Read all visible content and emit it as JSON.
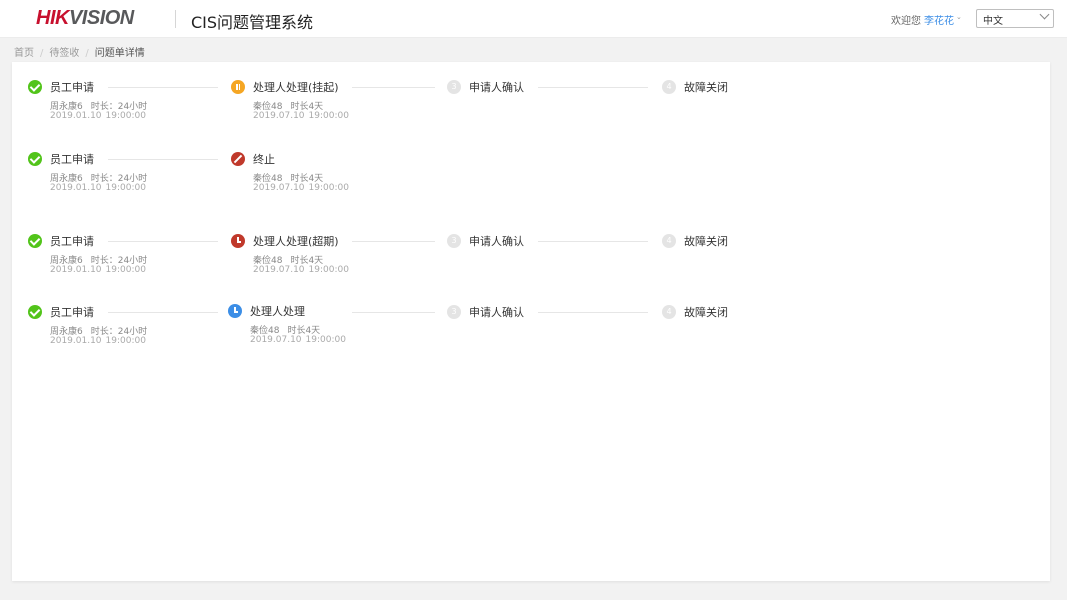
{
  "header": {
    "logo_red": "HIK",
    "logo_grey": "VISION",
    "app_title": "CIS问题管理系统",
    "welcome": "欢迎您",
    "username": "李花花",
    "language": "中文"
  },
  "breadcrumb": [
    "首页",
    "待签收",
    "问题单详情"
  ],
  "flows": [
    {
      "steps": [
        {
          "status": "done",
          "title": "员工申请",
          "person": "周永康6",
          "duration": "时长：24小时",
          "date": "2019.01.10",
          "time": "19:00:00"
        },
        {
          "status": "pause",
          "title": "处理人处理(挂起)",
          "person": "秦俭48",
          "duration": "时长4天",
          "date": "2019.07.10",
          "time": "19:00:00"
        },
        {
          "status": "wait",
          "num": "3",
          "title": "申请人确认"
        },
        {
          "status": "wait",
          "num": "4",
          "title": "故障关闭"
        }
      ]
    },
    {
      "steps": [
        {
          "status": "done",
          "title": "员工申请",
          "person": "周永康6",
          "duration": "时长：24小时",
          "date": "2019.01.10",
          "time": "19:00:00"
        },
        {
          "status": "stop",
          "title": "终止",
          "person": "秦俭48",
          "duration": "时长4天",
          "date": "2019.07.10",
          "time": "19:00:00"
        }
      ]
    },
    {
      "steps": [
        {
          "status": "done",
          "title": "员工申请",
          "person": "周永康6",
          "duration": "时长：24小时",
          "date": "2019.01.10",
          "time": "19:00:00"
        },
        {
          "status": "overdue",
          "title": "处理人处理(超期)",
          "person": "秦俭48",
          "duration": "时长4天",
          "date": "2019.07.10",
          "time": "19:00:00"
        },
        {
          "status": "wait",
          "num": "3",
          "title": "申请人确认"
        },
        {
          "status": "wait",
          "num": "4",
          "title": "故障关闭"
        }
      ]
    },
    {
      "steps": [
        {
          "status": "done",
          "title": "员工申请",
          "person": "周永康6",
          "duration": "时长：24小时",
          "date": "2019.01.10",
          "time": "19:00:00"
        },
        {
          "status": "active",
          "title": "处理人处理",
          "person": "秦俭48",
          "duration": "时长4天",
          "date": "2019.07.10",
          "time": "19:00:00"
        },
        {
          "status": "wait",
          "num": "3",
          "title": "申请人确认"
        },
        {
          "status": "wait",
          "num": "4",
          "title": "故障关闭"
        }
      ]
    }
  ],
  "colors": {
    "done": "#52c41a",
    "pause": "#f5a623",
    "stop": "#c0392b",
    "overdue": "#c0392b",
    "active": "#3c8ee6",
    "wait": "#e4e4e4",
    "brand_red": "#c8102e",
    "link_blue": "#3c8ee6"
  }
}
